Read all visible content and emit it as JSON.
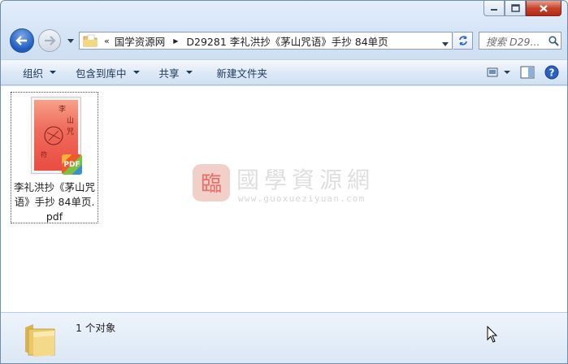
{
  "window": {
    "caption_buttons": [
      "minimize",
      "maximize",
      "close"
    ]
  },
  "address_bar": {
    "overflow_glyph": "«",
    "crumbs": [
      "国学资源网",
      "D29281 李礼洪抄《茅山咒语》手抄 84单页"
    ]
  },
  "search": {
    "placeholder": "搜索 D29..."
  },
  "toolbar": {
    "organize": "组织",
    "include_in_library": "包含到库中",
    "share": "共享",
    "new_folder": "新建文件夹"
  },
  "files": [
    {
      "name": "李礼洪抄《茅山咒语》手抄 84单页.pdf",
      "badge": "PDF"
    }
  ],
  "watermark": {
    "title": "國學資源網",
    "url": "www.guoxueziyuan.com"
  },
  "status": {
    "count_text": "1 个对象"
  },
  "colors": {
    "accent": "#1f5bbf",
    "toolbar_text": "#1e395b",
    "close_button": "#c8432c"
  }
}
